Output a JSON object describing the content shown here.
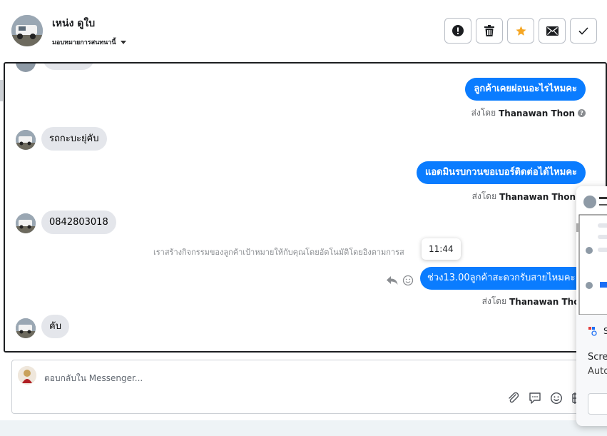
{
  "header": {
    "contact_name": "เหน่ง ดูใบ",
    "assign_label": "มอบหมายการสนทนานี้",
    "actions": [
      {
        "name": "report-button",
        "icon": "exclamation-circle-icon"
      },
      {
        "name": "delete-button",
        "icon": "trash-icon"
      },
      {
        "name": "star-button",
        "icon": "star-icon",
        "color": "#f5a623"
      },
      {
        "name": "mark-unread-button",
        "icon": "envelope-icon"
      },
      {
        "name": "mark-done-button",
        "icon": "check-icon"
      }
    ]
  },
  "messages": [
    {
      "direction": "outgoing",
      "text": "ลูกค้าเคยผ่อนอะไรไหมคะ",
      "sent_by_prefix": "ส่งโดย",
      "sent_by_name": "Thanawan Thon"
    },
    {
      "direction": "incoming",
      "text": "รถกะบะยุ่คับ"
    },
    {
      "direction": "outgoing",
      "text": "แอดมินรบกวนขอเบอร์ติดต่อได้ไหมคะ",
      "sent_by_prefix": "ส่งโดย",
      "sent_by_name": "Thanawan Thon"
    },
    {
      "direction": "incoming",
      "text": "0842803018"
    },
    {
      "direction": "system",
      "text": "เราสร้างกิจกรรมของลูกค้าเป้าหมายให้กับคุณโดยอัตโนมัติโดยอิงตามการส"
    },
    {
      "direction": "outgoing",
      "text": "ช่วง13.00ลูกค้าสะดวกรับสายไหมคะ",
      "sent_by_prefix": "ส่งโดย",
      "sent_by_name": "Thanawan Thon",
      "tooltip_time": "11:44"
    },
    {
      "direction": "incoming",
      "text": "คับ"
    }
  ],
  "composer": {
    "placeholder": "ตอบกลับใน Messenger...",
    "tools": [
      "paperclip-icon",
      "quick-reply-icon",
      "emoji-icon",
      "baht-icon"
    ]
  },
  "overlay": {
    "title_fragment": "S",
    "text_line1": "Scre",
    "text_line2": "Auto"
  },
  "colors": {
    "outgoing_bubble": "#0a7cff",
    "incoming_bubble": "#e4e6eb",
    "star": "#f5a623"
  }
}
